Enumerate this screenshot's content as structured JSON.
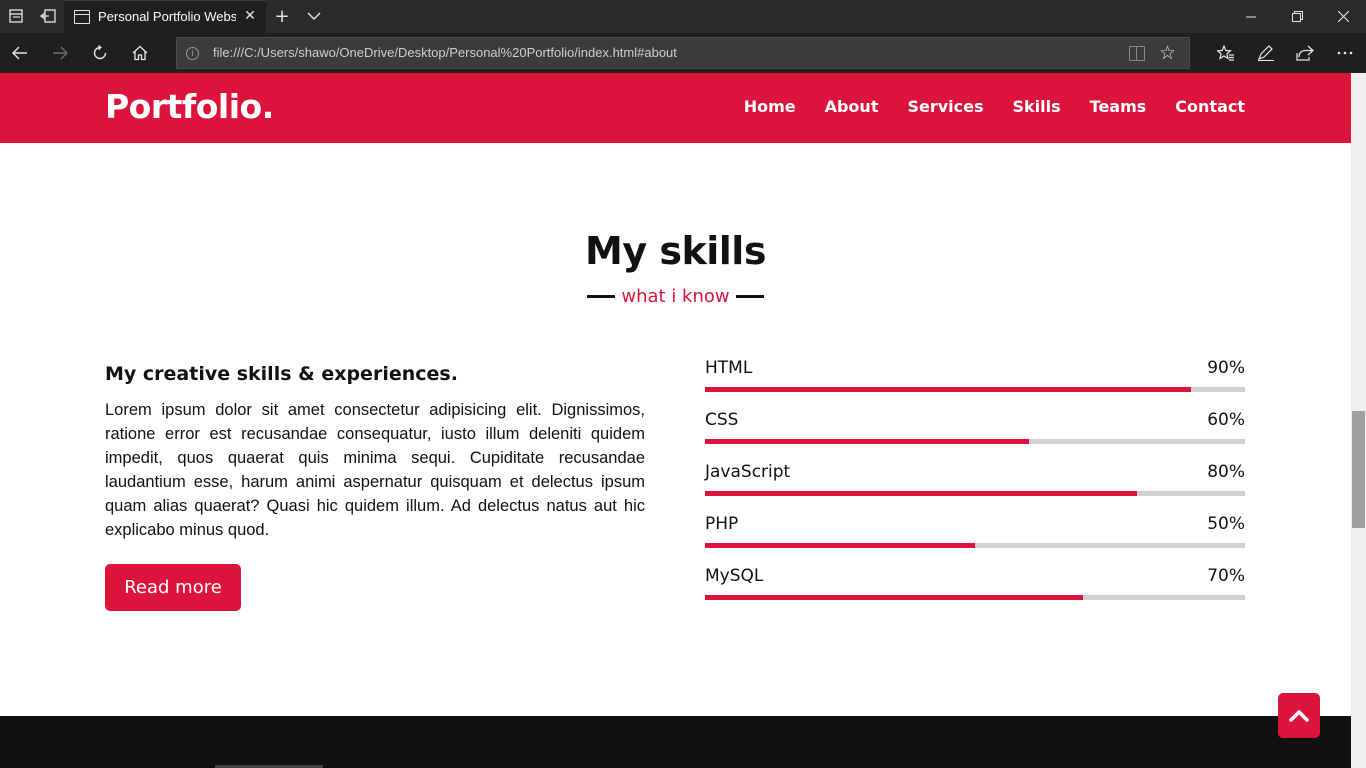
{
  "browser": {
    "tab_title": "Personal Portfolio Webs",
    "url": "file:///C:/Users/shawo/OneDrive/Desktop/Personal%20Portfolio/index.html#about",
    "icons": {
      "tab_manager": "tab-manager-icon",
      "set_aside": "set-aside-tabs-icon",
      "new_tab": "plus-icon",
      "tab_list": "chevron-down-icon",
      "back": "arrow-left-icon",
      "forward": "arrow-right-icon",
      "refresh": "refresh-icon",
      "home": "home-icon",
      "favorites": "favorites-icon",
      "pen": "pen-icon",
      "share": "share-icon",
      "more": "more-icon"
    }
  },
  "site": {
    "logo": "Portfolio.",
    "nav": [
      "Home",
      "About",
      "Services",
      "Skills",
      "Teams",
      "Contact"
    ],
    "accent": "#dc143c"
  },
  "skills_section": {
    "title": "My skills",
    "subtitle": "what i know",
    "about_heading": "My creative skills & experiences.",
    "about_text": "Lorem ipsum dolor sit amet consectetur adipisicing elit. Dignissimos, ratione error est recusandae consequatur, iusto illum deleniti quidem impedit, quos quaerat quis minima sequi. Cupiditate recusandae laudantium esse, harum animi aspernatur quisquam et delectus ipsum quam alias quaerat? Quasi hic quidem illum. Ad delectus natus aut hic explicabo minus quod.",
    "read_more": "Read more",
    "skills": [
      {
        "name": "HTML",
        "percent_label": "90%",
        "level": 90
      },
      {
        "name": "CSS",
        "percent_label": "60%",
        "level": 60
      },
      {
        "name": "JavaScript",
        "percent_label": "80%",
        "level": 80
      },
      {
        "name": "PHP",
        "percent_label": "50%",
        "level": 50
      },
      {
        "name": "MySQL",
        "percent_label": "70%",
        "level": 70
      }
    ]
  },
  "scroll_top_icon": "chevron-up-icon"
}
